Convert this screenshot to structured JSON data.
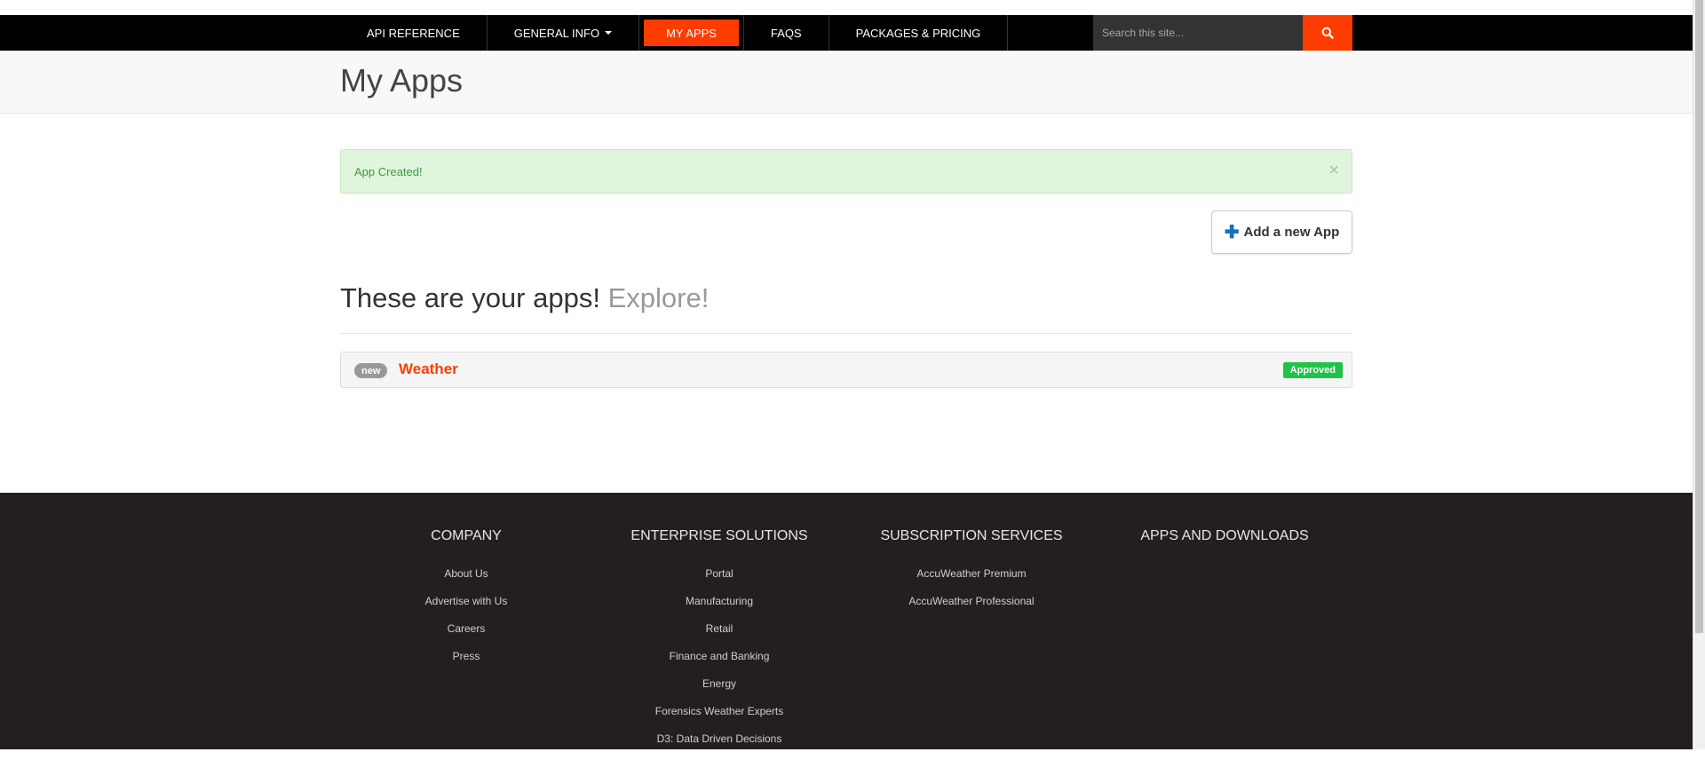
{
  "nav": {
    "items": [
      "API REFERENCE",
      "GENERAL INFO",
      "MY APPS",
      "FAQS",
      "PACKAGES & PRICING"
    ],
    "active": "MY APPS",
    "search_placeholder": "Search this site..."
  },
  "colors": {
    "accent": "#ff3c00",
    "approved": "#1ec44a",
    "footer_bg": "#231f1e"
  },
  "page": {
    "title": "My Apps"
  },
  "alert": {
    "message": "App Created!",
    "close": "×"
  },
  "actions": {
    "add_app_label": "Add a new App"
  },
  "apps": {
    "heading": "These are your apps!",
    "heading_sub": "Explore!",
    "list": [
      {
        "badge": "new",
        "name": "Weather",
        "status": "Approved"
      }
    ]
  },
  "footer": {
    "columns": [
      {
        "title": "COMPANY",
        "links": [
          "About Us",
          "Advertise with Us",
          "Careers",
          "Press"
        ]
      },
      {
        "title": "ENTERPRISE SOLUTIONS",
        "links": [
          "Portal",
          "Manufacturing",
          "Retail",
          "Finance and Banking",
          "Energy",
          "Forensics Weather Experts",
          "D3: Data Driven Decisions"
        ]
      },
      {
        "title": "SUBSCRIPTION SERVICES",
        "links": [
          "AccuWeather Premium",
          "AccuWeather Professional"
        ]
      },
      {
        "title": "APPS AND DOWNLOADS",
        "links": []
      }
    ]
  }
}
